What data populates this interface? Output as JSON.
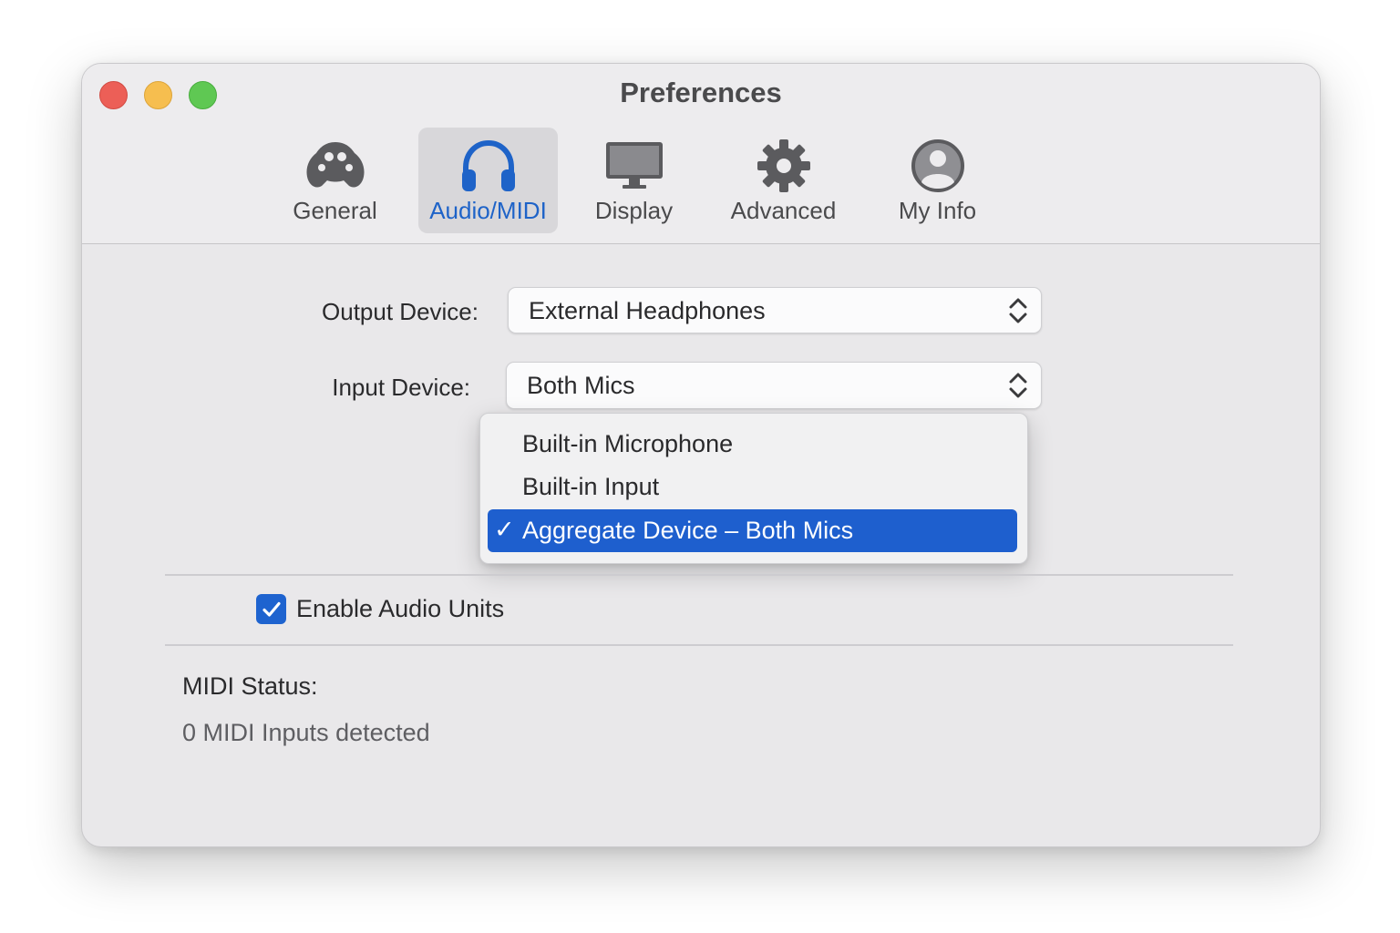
{
  "window": {
    "title": "Preferences"
  },
  "toolbar": {
    "tabs": [
      {
        "label": "General",
        "icon": "gamepad-icon"
      },
      {
        "label": "Audio/MIDI",
        "icon": "headphones-icon",
        "active": true
      },
      {
        "label": "Display",
        "icon": "monitor-icon"
      },
      {
        "label": "Advanced",
        "icon": "gear-icon"
      },
      {
        "label": "My Info",
        "icon": "user-icon"
      }
    ]
  },
  "audio": {
    "output_label": "Output Device:",
    "output_value": "External Headphones",
    "input_label": "Input Device:",
    "input_value": "Both Mics",
    "input_menu": {
      "options": [
        "Built-in Microphone",
        "Built-in Input",
        "Aggregate Device – Both Mics"
      ],
      "selected_index": 2,
      "check_glyph": "✓"
    },
    "audio_units_label": "Enable Audio Units",
    "audio_units_checked": true
  },
  "midi": {
    "status_label": "MIDI Status:",
    "status_value": "0 MIDI Inputs detected"
  },
  "colors": {
    "accent": "#1e63c8",
    "selection": "#1e5fce",
    "close": "#ec5f57",
    "minimize": "#f6be4f",
    "maximize": "#5fc853"
  }
}
